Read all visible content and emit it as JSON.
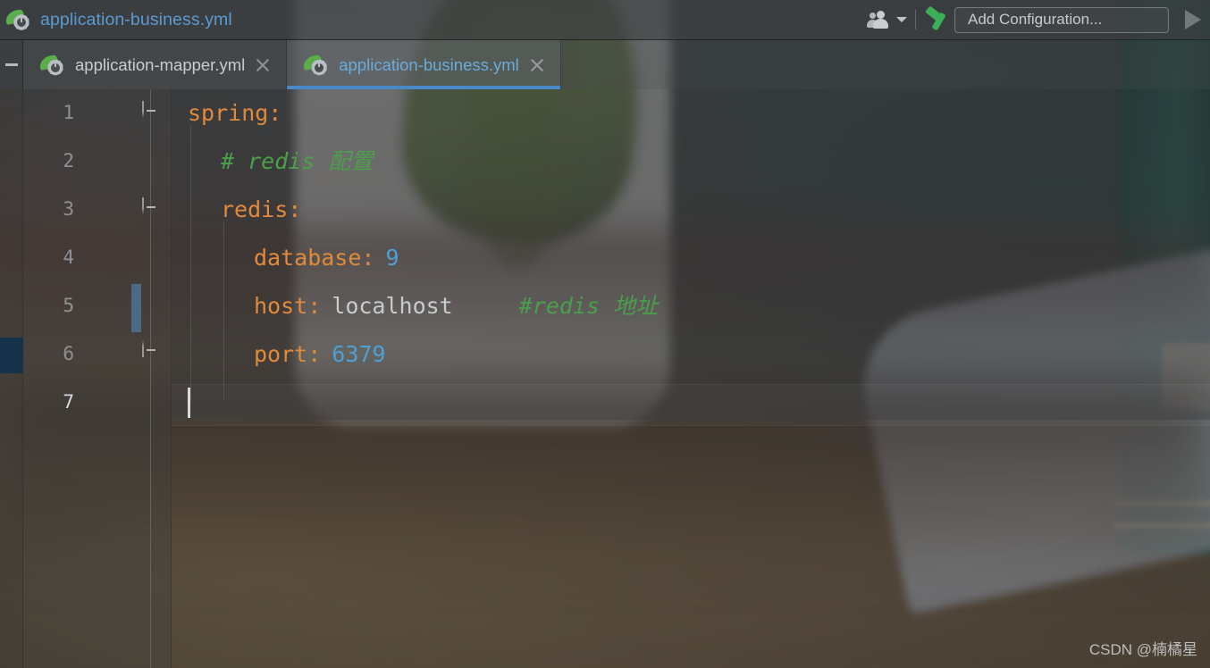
{
  "window": {
    "title": "application-business.yml",
    "app_icon": "spring-boot-leaf-icon"
  },
  "toolbar": {
    "breadcrumb_title": "application-business.yml",
    "people_icon": "people-icon",
    "people_dropdown_icon": "chevron-down-icon",
    "build_icon": "hammer-icon",
    "add_configuration_label": "Add Configuration...",
    "run_icon": "run-play-icon",
    "collapse_icon": "minimize-dash-icon"
  },
  "tabs": [
    {
      "label": "application-mapper.yml",
      "icon": "spring-boot-leaf-icon",
      "active": false,
      "close_icon": "close-icon"
    },
    {
      "label": "application-business.yml",
      "icon": "spring-boot-leaf-icon",
      "active": true,
      "close_icon": "close-icon"
    }
  ],
  "editor": {
    "language": "yaml",
    "cursor_line": 7,
    "line_numbers": [
      "1",
      "2",
      "3",
      "4",
      "5",
      "6",
      "7"
    ],
    "lines": [
      {
        "n": "1",
        "indent": 0,
        "tokens": [
          {
            "t": "spring",
            "c": "key"
          },
          {
            "t": ":",
            "c": "colon"
          }
        ]
      },
      {
        "n": "2",
        "indent": 1,
        "tokens": [
          {
            "t": "# redis 配置",
            "c": "comment"
          }
        ]
      },
      {
        "n": "3",
        "indent": 1,
        "tokens": [
          {
            "t": "redis",
            "c": "key"
          },
          {
            "t": ":",
            "c": "colon"
          }
        ]
      },
      {
        "n": "4",
        "indent": 2,
        "tokens": [
          {
            "t": "database",
            "c": "key"
          },
          {
            "t": ":",
            "c": "colon"
          },
          {
            "t": " 9",
            "c": "number"
          }
        ]
      },
      {
        "n": "5",
        "indent": 2,
        "tokens": [
          {
            "t": "host",
            "c": "key"
          },
          {
            "t": ":",
            "c": "colon"
          },
          {
            "t": " localhost",
            "c": "string"
          },
          {
            "t": "    #redis 地址",
            "c": "comment"
          }
        ]
      },
      {
        "n": "6",
        "indent": 2,
        "tokens": [
          {
            "t": "port",
            "c": "key"
          },
          {
            "t": ":",
            "c": "colon"
          },
          {
            "t": " 6379",
            "c": "number"
          }
        ]
      },
      {
        "n": "7",
        "indent": 0,
        "tokens": []
      }
    ],
    "line_1_text": "spring:",
    "line_2_text": "# redis 配置",
    "line_3_text": "redis:",
    "line_4_key": "database:",
    "line_4_value": "9",
    "line_5_key": "host:",
    "line_5_value": "localhost",
    "line_5_comment": "#redis 地址",
    "line_6_key": "port:",
    "line_6_value": "6379",
    "fold_markers": [
      {
        "line": 1,
        "state": "open"
      },
      {
        "line": 3,
        "state": "open"
      },
      {
        "line": 6,
        "state": "end"
      }
    ],
    "change_marker_line": 5,
    "bookmark_marker_line": 6
  },
  "colors": {
    "key": "#e08a3c",
    "value_number": "#4d9fd6",
    "comment": "#4aa04a",
    "string": "#c8cbce",
    "tab_active": "#6aabdc",
    "tab_underline": "#4a88c7",
    "build_green": "#3cae59",
    "change_bar": "#4b6a86",
    "bookmark": "#15324a"
  },
  "watermark": {
    "text": "CSDN @楠橘星"
  }
}
